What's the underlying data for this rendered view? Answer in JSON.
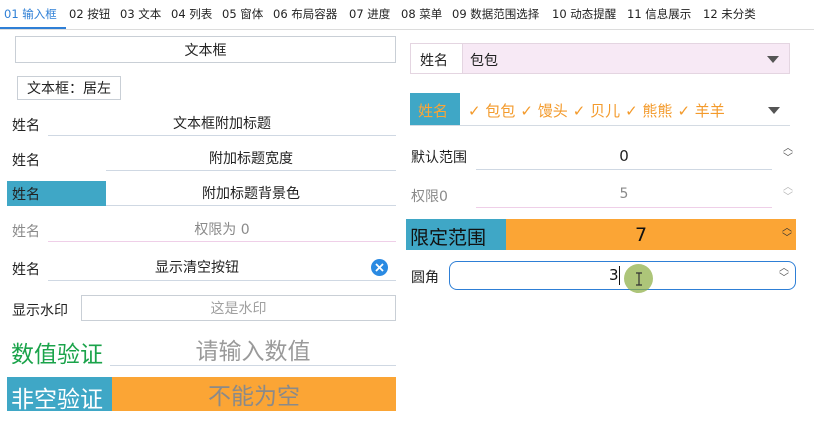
{
  "tabs": [
    {
      "label": "01 输入框"
    },
    {
      "label": "02 按钮"
    },
    {
      "label": "03 文本"
    },
    {
      "label": "04 列表"
    },
    {
      "label": "05 窗体"
    },
    {
      "label": "06 布局容器"
    },
    {
      "label": "07 进度"
    },
    {
      "label": "08 菜单"
    },
    {
      "label": "09 数据范围选择"
    },
    {
      "label": "10 动态提醒"
    },
    {
      "label": "11 信息展示"
    },
    {
      "label": "12 未分类"
    }
  ],
  "left": {
    "textbox_value": "文本框",
    "textbox_left_value": "文本框：居左",
    "addon_title": {
      "label": "姓名",
      "value": "文本框附加标题"
    },
    "addon_width": {
      "label": "姓名",
      "value": "附加标题宽度"
    },
    "addon_bg": {
      "label": "姓名",
      "value": "附加标题背景色"
    },
    "readonly": {
      "label": "姓名",
      "value": "权限为 0"
    },
    "clearable": {
      "label": "姓名",
      "value": "显示清空按钮"
    },
    "watermark": {
      "label": "显示水印",
      "placeholder": "这是水印"
    },
    "numeric": {
      "label": "数值验证",
      "placeholder": "请输入数值"
    },
    "required": {
      "label": "非空验证",
      "placeholder": "不能为空"
    }
  },
  "right": {
    "combo": {
      "label": "姓名",
      "value": "包包"
    },
    "multi": {
      "label": "姓名",
      "tags": [
        "包包",
        "馒头",
        "贝儿",
        "熊熊",
        "羊羊"
      ]
    },
    "range_default": {
      "label": "默认范围",
      "value": "0"
    },
    "range_readonly": {
      "label": "权限0",
      "value": "5"
    },
    "range_limited": {
      "label": "限定范围",
      "value": "7"
    },
    "rounded": {
      "label": "圆角",
      "value": "3"
    }
  },
  "colors": {
    "accent_blue": "#2e7fd6",
    "teal": "#3fa7c6",
    "orange": "#fba535",
    "green": "#1aa34a",
    "pink_bg": "#f7e9f5",
    "clear_btn": "#2a8ae2"
  }
}
